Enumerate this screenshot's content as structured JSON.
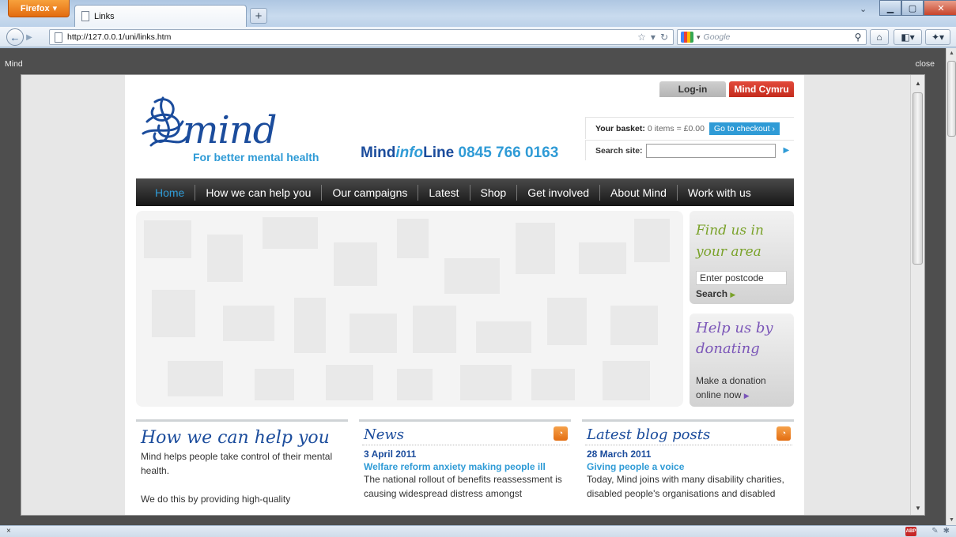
{
  "browser": {
    "app_button": "Firefox",
    "tab_title": "Links",
    "new_tab": "+",
    "url": "http://127.0.0.1/uni/links.htm",
    "search_placeholder": "Google",
    "status_close": "×"
  },
  "lightbox": {
    "title": "Mind",
    "close_label": "close"
  },
  "site": {
    "login": "Log-in",
    "cymru": "Mind Cymru",
    "logo_word": "mind",
    "logo_tagline": "For better mental health",
    "infoline_prefix": "Mind",
    "infoline_info": "info",
    "infoline_line": "Line",
    "infoline_number": "0845 766 0163",
    "basket_label": "Your basket:",
    "basket_value": "0 items = £0.00",
    "checkout": "Go to checkout ›",
    "search_label": "Search site:",
    "nav": [
      "Home",
      "How we can help you",
      "Our campaigns",
      "Latest",
      "Shop",
      "Get involved",
      "About Mind",
      "Work with us"
    ],
    "find_us": {
      "title": "Find us in your area",
      "postcode": "Enter postcode",
      "search": "Search"
    },
    "donate": {
      "title": "Help us by donating",
      "text": "Make a donation online now"
    },
    "help": {
      "heading": "How we can help you",
      "p1": "Mind helps people take control of their mental health.",
      "p2": "We do this by providing high-quality"
    },
    "news": {
      "heading": "News",
      "date": "3 April 2011",
      "headline": "Welfare reform anxiety making people ill",
      "text": "The national rollout of benefits reassessment is causing widespread distress amongst"
    },
    "blog": {
      "heading": "Latest blog posts",
      "date": "28 March 2011",
      "headline": "Giving people a voice",
      "text": "Today, Mind joins with many disability charities, disabled people's organisations and disabled"
    }
  },
  "colors": {
    "brand_dark_blue": "#1b4c9c",
    "brand_light_blue": "#2f9bd6",
    "cymru_red": "#d43a2b",
    "find_green": "#7aa22a",
    "donate_purple": "#7b56b8"
  }
}
